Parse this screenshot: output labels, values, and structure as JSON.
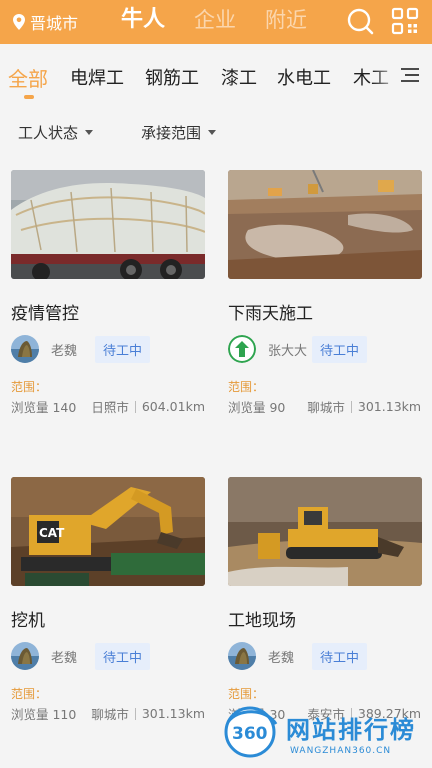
{
  "header": {
    "city": "晋城市",
    "nav": [
      "牛人",
      "企业",
      "附近"
    ],
    "active_nav": 0
  },
  "categories": [
    "全部",
    "电焊工",
    "钢筋工",
    "漆工",
    "水电工",
    "木工"
  ],
  "filters": {
    "worker_status": "工人状态",
    "scope": "承接范围"
  },
  "cards": [
    {
      "title": "疫情管控",
      "user": "老魏",
      "status": "待工中",
      "range_label": "范围：",
      "views": "浏览量 140",
      "city": "日照市",
      "distance": "604.01km",
      "avatar": "landscape",
      "thumb": "truck"
    },
    {
      "title": "下雨天施工",
      "user": "张大大",
      "status": "待工中",
      "range_label": "范围：",
      "views": "浏览量 90",
      "city": "聊城市",
      "distance": "301.13km",
      "avatar": "arrow",
      "thumb": "mud"
    },
    {
      "title": "挖机",
      "user": "老魏",
      "status": "待工中",
      "range_label": "范围：",
      "views": "浏览量 110",
      "city": "聊城市",
      "distance": "301.13km",
      "avatar": "landscape",
      "thumb": "excavator"
    },
    {
      "title": "工地现场",
      "user": "老魏",
      "status": "待工中",
      "range_label": "范围：",
      "views": "浏览量 30",
      "city": "泰安市",
      "distance": "389.27km",
      "avatar": "landscape",
      "thumb": "bulldozer"
    }
  ],
  "watermark": {
    "logo_text": "360",
    "title": "网站排行榜",
    "sub": "WANGZHAN360.CN"
  },
  "colors": {
    "accent": "#f5a54a",
    "status_bg": "#e6eefb",
    "status_text": "#4a7fd6"
  },
  "icons": {
    "location": "location-pin-icon",
    "search": "search-icon",
    "scan": "scan-icon",
    "menu": "menu-icon"
  }
}
